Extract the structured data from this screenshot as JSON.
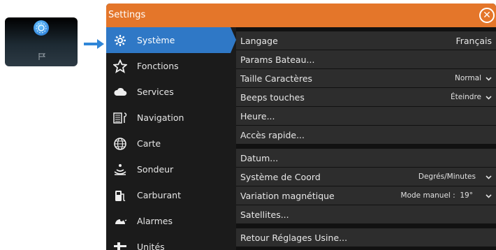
{
  "window": {
    "title": "Settings"
  },
  "sidebar": {
    "items": [
      {
        "label": "Système",
        "icon": "gear-icon",
        "active": true
      },
      {
        "label": "Fonctions",
        "icon": "star-icon"
      },
      {
        "label": "Services",
        "icon": "cloud-icon"
      },
      {
        "label": "Navigation",
        "icon": "navigation-icon"
      },
      {
        "label": "Carte",
        "icon": "globe-icon"
      },
      {
        "label": "Sondeur",
        "icon": "sonar-icon"
      },
      {
        "label": "Carburant",
        "icon": "fuel-icon"
      },
      {
        "label": "Alarmes",
        "icon": "alarm-icon"
      },
      {
        "label": "Unités",
        "icon": "units-icon"
      }
    ]
  },
  "settings": {
    "langage": {
      "label": "Langage",
      "value": "Français"
    },
    "params_bateau": {
      "label": "Params Bateau..."
    },
    "taille": {
      "label": "Taille Caractères",
      "value": "Normal"
    },
    "beeps": {
      "label": "Beeps touches",
      "value": "Éteindre"
    },
    "heure": {
      "label": "Heure..."
    },
    "acces": {
      "label": "Accès rapide..."
    },
    "datum": {
      "label": "Datum..."
    },
    "coord": {
      "label": "Système de Coord",
      "value": "Degrés/Minutes"
    },
    "variation": {
      "label": "Variation magnétique",
      "value": "Mode manuel :  19°"
    },
    "satellites": {
      "label": "Satellites..."
    },
    "retour": {
      "label": "Retour Réglages Usine..."
    }
  },
  "colors": {
    "accent": "#e4762a",
    "selection": "#2f78c6"
  }
}
